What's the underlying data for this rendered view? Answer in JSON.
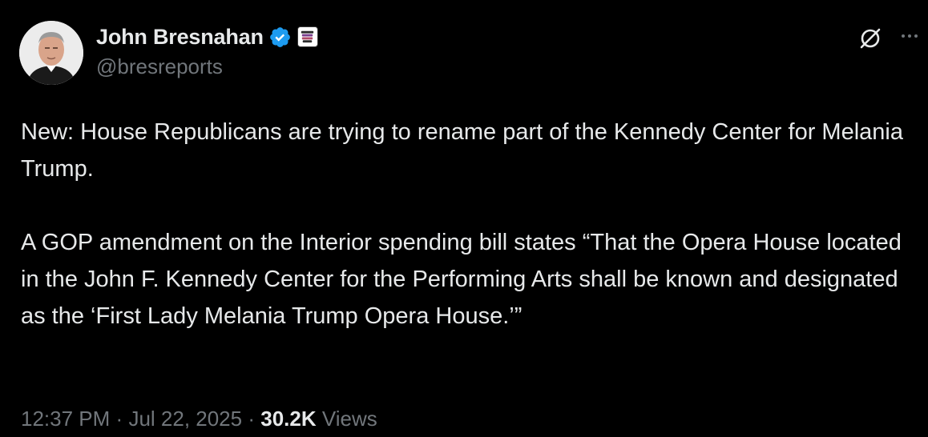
{
  "author": {
    "display_name": "John Bresnahan",
    "handle": "@bresreports",
    "verified_icon": "verified-badge-icon",
    "affiliate_icon": "affiliate-badge-icon"
  },
  "actions": {
    "grok_icon": "grok-icon",
    "more_icon": "more-icon"
  },
  "tweet": {
    "paragraphs": [
      "New: House Republicans are trying to rename part of the Kennedy Center for Melania Trump.",
      "A GOP amendment on the Interior spending bill states “That the Opera House located in the John F. Kennedy Center for the Performing Arts shall be known and designated as the ‘First Lady Melania Trump Opera House.’”"
    ]
  },
  "meta": {
    "time": "12:37 PM",
    "separator": "·",
    "date": "Jul 22, 2025",
    "views_count": "30.2K",
    "views_label": "Views"
  },
  "colors": {
    "background": "#000000",
    "text_primary": "#e7e9ea",
    "text_secondary": "#71767b",
    "verified_blue": "#1d9bf0"
  }
}
